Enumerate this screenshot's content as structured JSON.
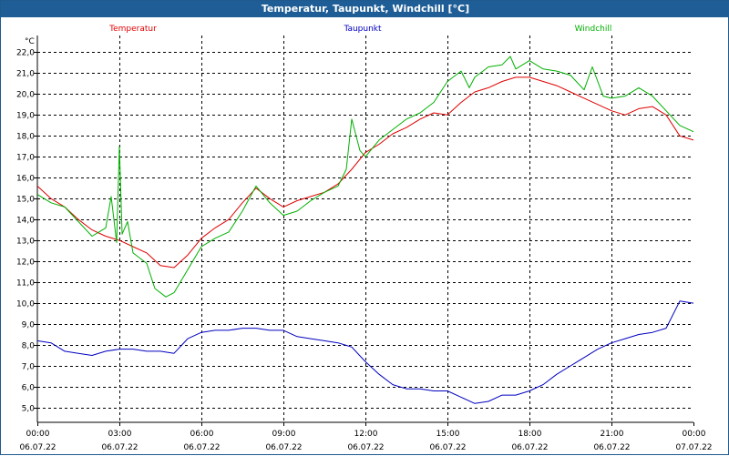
{
  "chart_data": {
    "type": "line",
    "title": "Temperatur, Taupunkt, Windchill [°C]",
    "ylabel": "°C",
    "ylim": [
      4.3,
      22.8
    ],
    "xlim": [
      0,
      24
    ],
    "grid": true,
    "yticks": [
      "22,0",
      "21,0",
      "20,0",
      "19,0",
      "18,0",
      "17,0",
      "16,0",
      "15,0",
      "14,0",
      "13,0",
      "12,0",
      "11,0",
      "10,0",
      "9,0",
      "8,0",
      "7,0",
      "6,0",
      "5,0"
    ],
    "ytick_values": [
      22,
      21,
      20,
      19,
      18,
      17,
      16,
      15,
      14,
      13,
      12,
      11,
      10,
      9,
      8,
      7,
      6,
      5
    ],
    "xticks": [
      {
        "time": "00:00",
        "date": "06.07.22",
        "h": 0
      },
      {
        "time": "03:00",
        "date": "06.07.22",
        "h": 3
      },
      {
        "time": "06:00",
        "date": "06.07.22",
        "h": 6
      },
      {
        "time": "09:00",
        "date": "06.07.22",
        "h": 9
      },
      {
        "time": "12:00",
        "date": "06.07.22",
        "h": 12
      },
      {
        "time": "15:00",
        "date": "06.07.22",
        "h": 15
      },
      {
        "time": "18:00",
        "date": "06.07.22",
        "h": 18
      },
      {
        "time": "21:00",
        "date": "06.07.22",
        "h": 21
      },
      {
        "time": "00:00",
        "date": "07.07.22",
        "h": 24
      }
    ],
    "series": [
      {
        "name": "Temperatur",
        "color": "#e00000",
        "x": [
          0,
          0.5,
          1,
          1.5,
          2,
          2.5,
          3,
          3.5,
          4,
          4.5,
          5,
          5.5,
          6,
          6.5,
          7,
          7.5,
          8,
          8.5,
          9,
          9.5,
          10,
          10.5,
          11,
          11.5,
          12,
          12.5,
          13,
          13.5,
          14,
          14.5,
          15,
          15.5,
          16,
          16.5,
          17,
          17.5,
          18,
          18.5,
          19,
          19.5,
          20,
          20.5,
          21,
          21.5,
          22,
          22.5,
          23,
          23.5,
          24
        ],
        "y": [
          15.6,
          15.0,
          14.6,
          14.0,
          13.5,
          13.2,
          13.0,
          12.7,
          12.4,
          11.8,
          11.7,
          12.3,
          13.1,
          13.6,
          14.0,
          14.8,
          15.5,
          15.0,
          14.6,
          14.9,
          15.1,
          15.3,
          15.7,
          16.4,
          17.2,
          17.6,
          18.1,
          18.4,
          18.8,
          19.1,
          19.0,
          19.6,
          20.1,
          20.3,
          20.6,
          20.8,
          20.8,
          20.6,
          20.4,
          20.1,
          19.8,
          19.5,
          19.2,
          19.0,
          19.3,
          19.4,
          19.0,
          18.0,
          17.8
        ]
      },
      {
        "name": "Taupunkt",
        "color": "#0000c0",
        "x": [
          0,
          0.5,
          1,
          1.5,
          2,
          2.5,
          3,
          3.5,
          4,
          4.5,
          5,
          5.5,
          6,
          6.5,
          7,
          7.5,
          8,
          8.5,
          9,
          9.5,
          10,
          10.5,
          11,
          11.5,
          12,
          12.5,
          13,
          13.5,
          14,
          14.5,
          15,
          15.5,
          16,
          16.5,
          17,
          17.5,
          18,
          18.5,
          19,
          19.5,
          20,
          20.5,
          21,
          21.5,
          22,
          22.5,
          23,
          23.5,
          24
        ],
        "y": [
          8.2,
          8.1,
          7.7,
          7.6,
          7.5,
          7.7,
          7.8,
          7.8,
          7.7,
          7.7,
          7.6,
          8.3,
          8.6,
          8.7,
          8.7,
          8.8,
          8.8,
          8.7,
          8.7,
          8.4,
          8.3,
          8.2,
          8.1,
          7.9,
          7.2,
          6.6,
          6.1,
          5.9,
          5.9,
          5.8,
          5.8,
          5.5,
          5.2,
          5.3,
          5.6,
          5.6,
          5.8,
          6.1,
          6.6,
          7.0,
          7.4,
          7.8,
          8.1,
          8.3,
          8.5,
          8.6,
          8.8,
          10.1,
          10.0
        ]
      },
      {
        "name": "Windchill",
        "color": "#00b000",
        "x": [
          0,
          0.5,
          1,
          1.5,
          2,
          2.5,
          2.7,
          2.9,
          3.0,
          3.1,
          3.3,
          3.5,
          4,
          4.3,
          4.7,
          5,
          5.5,
          6,
          6.5,
          7,
          7.5,
          8,
          8.5,
          9,
          9.5,
          10,
          10.5,
          11,
          11.3,
          11.5,
          11.8,
          12,
          12.5,
          13,
          13.5,
          14,
          14.5,
          15,
          15.5,
          15.8,
          16,
          16.5,
          17,
          17.3,
          17.5,
          18,
          18.5,
          19,
          19.5,
          20,
          20.3,
          20.7,
          21,
          21.5,
          22,
          22.5,
          23,
          23.5,
          24
        ],
        "y": [
          15.2,
          14.8,
          14.6,
          13.9,
          13.2,
          13.6,
          15.1,
          12.9,
          17.5,
          13.3,
          13.9,
          12.4,
          11.9,
          10.7,
          10.3,
          10.5,
          11.6,
          12.7,
          13.1,
          13.4,
          14.4,
          15.6,
          14.8,
          14.2,
          14.4,
          14.9,
          15.3,
          15.6,
          16.4,
          18.8,
          17.3,
          17.0,
          17.8,
          18.3,
          18.8,
          19.1,
          19.6,
          20.6,
          21.1,
          20.3,
          20.8,
          21.3,
          21.4,
          21.8,
          21.2,
          21.6,
          21.2,
          21.1,
          20.9,
          20.2,
          21.3,
          19.9,
          19.8,
          19.9,
          20.3,
          19.9,
          19.2,
          18.5,
          18.2
        ]
      }
    ]
  }
}
